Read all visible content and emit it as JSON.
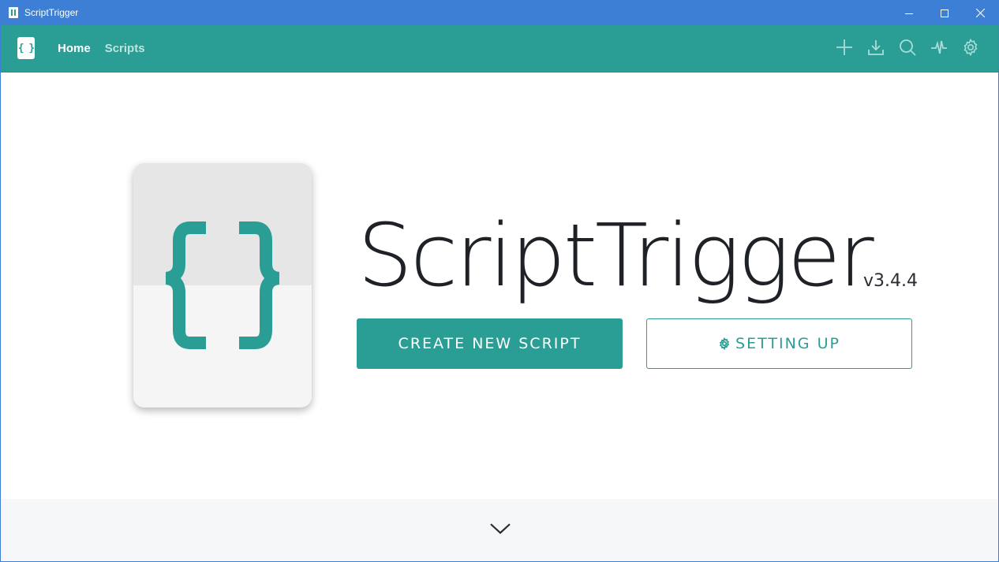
{
  "window": {
    "title": "ScriptTrigger",
    "controls": [
      "minimize-icon",
      "maximize-icon",
      "close-icon"
    ]
  },
  "header": {
    "logo_text": "{ }",
    "nav": [
      {
        "label": "Home",
        "active": true
      },
      {
        "label": "Scripts",
        "active": false
      }
    ],
    "actions": [
      "add-icon",
      "download-icon",
      "search-icon",
      "activity-icon",
      "gear-icon"
    ]
  },
  "main": {
    "app_name": "ScriptTrigger",
    "version": "v3.4.4",
    "create_label": "CREATE NEW SCRIPT",
    "setup_label": "SETTING UP"
  },
  "colors": {
    "accent": "#2a9d94",
    "titlebar": "#3c7fd4",
    "footer": "#f6f7f8"
  }
}
